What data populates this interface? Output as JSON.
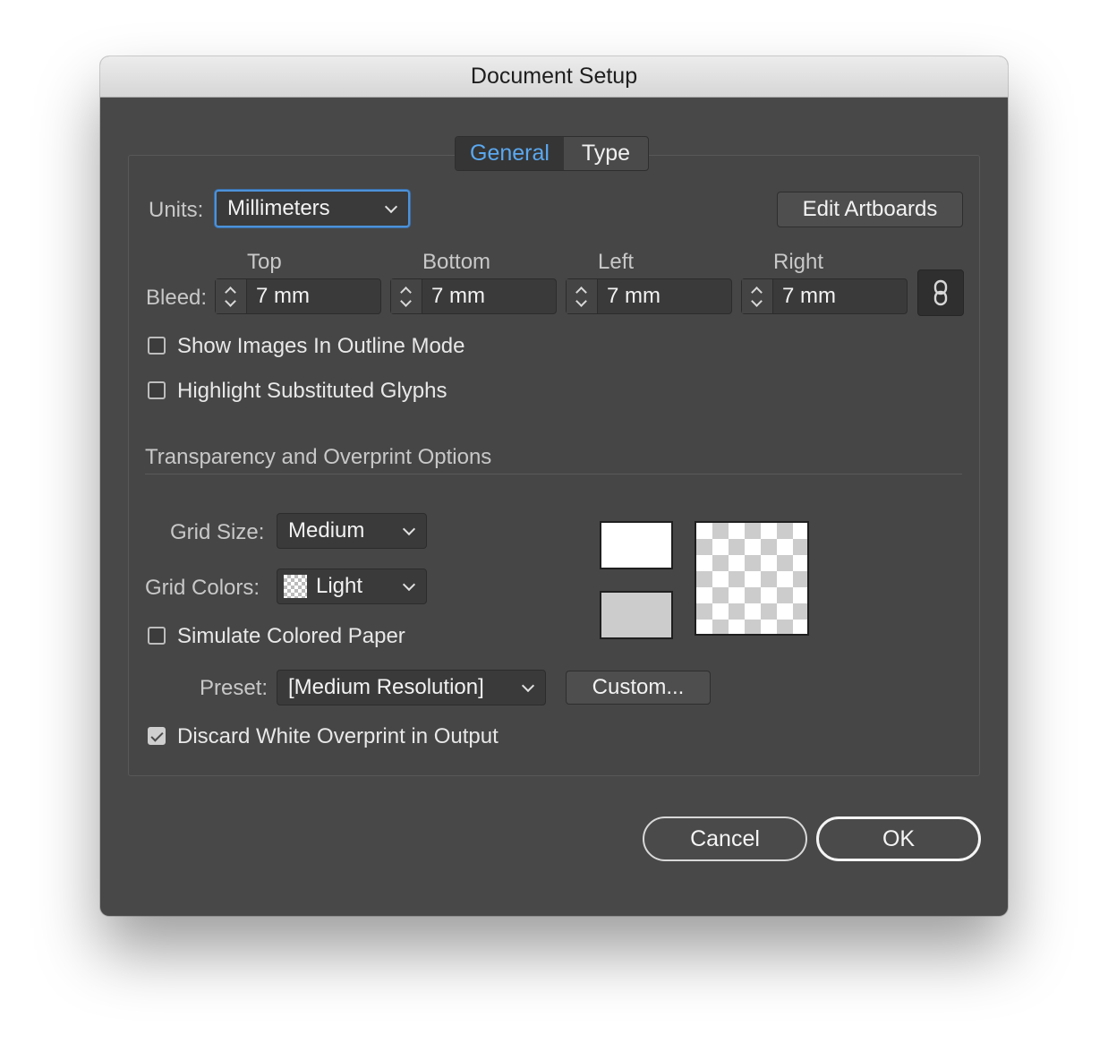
{
  "window": {
    "title": "Document Setup"
  },
  "tabs": [
    {
      "label": "General",
      "active": true
    },
    {
      "label": "Type",
      "active": false
    }
  ],
  "units": {
    "label": "Units:",
    "value": "Millimeters"
  },
  "edit_artboards_label": "Edit Artboards",
  "bleed": {
    "label": "Bleed:",
    "columns": [
      {
        "header": "Top",
        "value": "7 mm"
      },
      {
        "header": "Bottom",
        "value": "7 mm"
      },
      {
        "header": "Left",
        "value": "7 mm"
      },
      {
        "header": "Right",
        "value": "7 mm"
      }
    ],
    "link_icon": "chain-link-icon"
  },
  "options": {
    "show_images_outline": {
      "label": "Show Images In Outline Mode",
      "checked": false
    },
    "highlight_glyphs": {
      "label": "Highlight Substituted Glyphs",
      "checked": false
    }
  },
  "transparency": {
    "section_title": "Transparency and Overprint Options",
    "grid_size": {
      "label": "Grid Size:",
      "value": "Medium"
    },
    "grid_colors": {
      "label": "Grid Colors:",
      "value": "Light"
    },
    "simulate_paper": {
      "label": "Simulate Colored Paper",
      "checked": false
    },
    "preset": {
      "label": "Preset:",
      "value": "[Medium Resolution]"
    },
    "custom_label": "Custom...",
    "discard_white": {
      "label": "Discard White Overprint in Output",
      "checked": true
    },
    "swatch_colors": {
      "top": "#ffffff",
      "bottom": "#cccccc"
    }
  },
  "footer": {
    "cancel_label": "Cancel",
    "ok_label": "OK"
  }
}
